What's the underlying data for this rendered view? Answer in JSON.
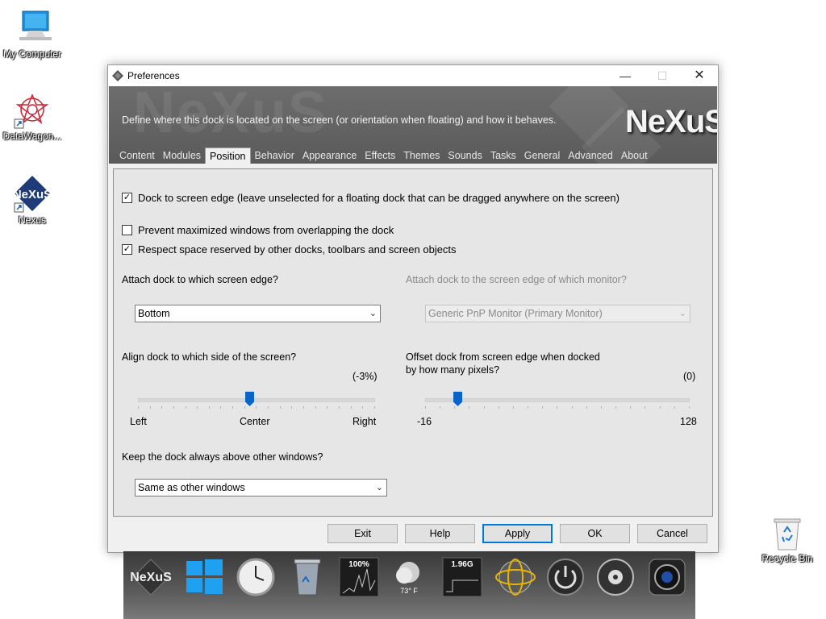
{
  "desktop": {
    "icons": [
      {
        "label": "My Computer"
      },
      {
        "label": "DataWagon..."
      },
      {
        "label": "Nexus",
        "logo_text": "NeXuS"
      },
      {
        "label": "Recycle Bin"
      }
    ]
  },
  "window": {
    "title": "Preferences",
    "controls": {
      "minimize": "—",
      "maximize": "☐",
      "close": "✕"
    },
    "banner": {
      "description": "Define where this dock is located on the screen (or orientation when floating) and how it behaves.",
      "logo": "NeXuS"
    },
    "tabs": [
      "Content",
      "Modules",
      "Position",
      "Behavior",
      "Appearance",
      "Effects",
      "Themes",
      "Sounds",
      "Tasks",
      "General",
      "Advanced",
      "About"
    ],
    "active_tab": "Position"
  },
  "position": {
    "dock_to_edge": {
      "label": "Dock to screen edge (leave unselected for a floating dock that can be dragged anywhere on the screen)",
      "checked": true
    },
    "prevent_maximized": {
      "label": "Prevent maximized windows from overlapping the dock",
      "checked": false
    },
    "respect_space": {
      "label": "Respect space reserved by other docks, toolbars and screen objects",
      "checked": true
    },
    "attach_edge": {
      "label": "Attach dock to which screen edge?",
      "value": "Bottom"
    },
    "attach_monitor": {
      "label": "Attach dock to the screen edge of which monitor?",
      "value": "Generic PnP Monitor (Primary Monitor)"
    },
    "align": {
      "label": "Align dock to which side of the screen?",
      "value_text": "(-3%)",
      "fraction": 0.47,
      "min_label": "Left",
      "mid_label": "Center",
      "max_label": "Right"
    },
    "offset": {
      "label_line1": "Offset dock from screen edge when docked",
      "label_line2": "by how many pixels?",
      "value_text": "(0)",
      "fraction": 0.11,
      "min_label": "-16",
      "max_label": "128"
    },
    "keep_above": {
      "label": "Keep the dock always above other windows?",
      "value": "Same as other windows"
    }
  },
  "buttons": {
    "exit": "Exit",
    "help": "Help",
    "apply": "Apply",
    "ok": "OK",
    "cancel": "Cancel"
  },
  "dock": {
    "logo": "NeXuS",
    "cpu_text": "100%",
    "weather_text": "73° F",
    "memory_text": "1.96G"
  },
  "colors": {
    "accent": "#0078d7",
    "slider_thumb": "#0a64c8"
  }
}
